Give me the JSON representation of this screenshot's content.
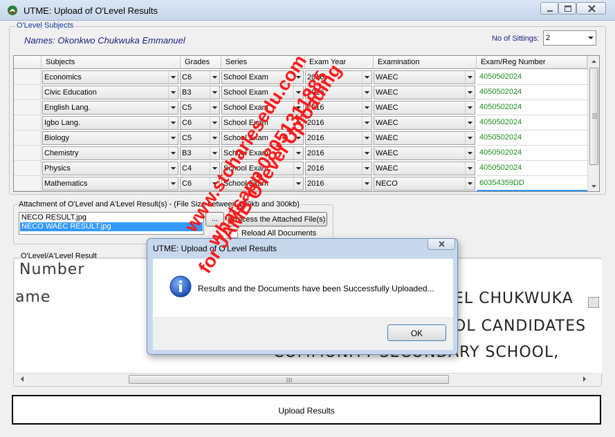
{
  "window": {
    "title": "UTME: Upload of O'Level Results"
  },
  "olevel_subjects": {
    "legend": "O'Level Subjects",
    "names_label": "Names: Okonkwo Chukwuka Emmanuel",
    "sittings_label": "No of Sittings:",
    "sittings_value": "2",
    "columns": [
      "Subjects",
      "Grades",
      "Series",
      "Exam Year",
      "Examination",
      "Exam/Reg Number"
    ],
    "rows": [
      {
        "subject": "Economics",
        "grade": "C6",
        "series": "School Exam",
        "year": "2016",
        "exam": "WAEC",
        "reg": "4050502024"
      },
      {
        "subject": "Civic Education",
        "grade": "B3",
        "series": "School Exam",
        "year": "2016",
        "exam": "WAEC",
        "reg": "4050502024"
      },
      {
        "subject": "English Lang.",
        "grade": "C5",
        "series": "School Exam",
        "year": "2016",
        "exam": "WAEC",
        "reg": "4050502024"
      },
      {
        "subject": "Igbo Lang.",
        "grade": "C6",
        "series": "School Exam",
        "year": "2016",
        "exam": "WAEC",
        "reg": "4050502024"
      },
      {
        "subject": "Biology",
        "grade": "C5",
        "series": "School Exam",
        "year": "2016",
        "exam": "WAEC",
        "reg": "4050502024"
      },
      {
        "subject": "Chemistry",
        "grade": "B3",
        "series": "School Exam",
        "year": "2016",
        "exam": "WAEC",
        "reg": "4050502024"
      },
      {
        "subject": "Physics",
        "grade": "C4",
        "series": "School Exam",
        "year": "2016",
        "exam": "WAEC",
        "reg": "4050502024"
      },
      {
        "subject": "Mathematics",
        "grade": "C6",
        "series": "School Exam",
        "year": "2016",
        "exam": "NECO",
        "reg": "60354359DD"
      }
    ]
  },
  "attachment": {
    "legend": "Attachment of O'Level and A'Level Result(s) - (File Size between 100kb and 300kb)",
    "files": [
      "NECO RESULT.jpg",
      "NECO WAEC RESULT.jpg"
    ],
    "selected_index": 1,
    "browse_label": "...",
    "process_label": "Process the Attached File(s)",
    "reload_label": "Reload All Documents"
  },
  "result_view": {
    "legend": "O'Level/A'Level Result",
    "doc_lines": [
      "Number",
      "ame",
      "EL CHUKWUKA",
      "OL CANDIDATES",
      "COMMUNITY SECONDARY SCHOOL,"
    ]
  },
  "upload_button": "Upload Results",
  "dialog": {
    "title": "UTME: Upload of O'Level Results",
    "message": "Results and the Documents have been Successfully Uploaded...",
    "ok_label": "OK"
  },
  "watermark": {
    "lines": [
      "www.stcharlesedu.com",
      "whatsapp 08051311885",
      "for JAMB O'level Uploading"
    ],
    "colors": {
      "red": "#ff1a1a",
      "blue": "#1a237e"
    }
  },
  "colors": {
    "reg_number_green": "#1f8b1f",
    "name_blue": "#1a237e",
    "selection_blue": "#3399ff"
  }
}
